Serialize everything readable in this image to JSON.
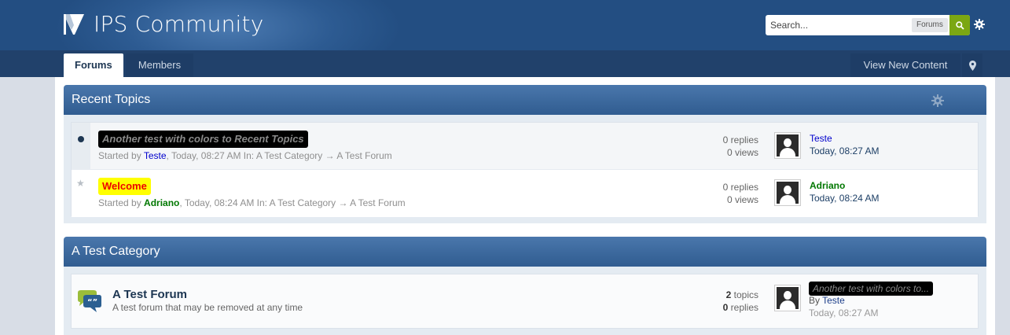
{
  "header": {
    "site_title": "IPS Community",
    "search_placeholder": "Search...",
    "search_scope": "Forums"
  },
  "nav": {
    "tabs": [
      {
        "label": "Forums",
        "active": true
      },
      {
        "label": "Members",
        "active": false
      }
    ],
    "view_new_content": "View New Content"
  },
  "recent_topics": {
    "title": "Recent Topics",
    "topics": [
      {
        "title": "Another test with colors to Recent Topics",
        "started_by_prefix": "Started by ",
        "author": "Teste",
        "meta_suffix": ", Today, 08:27 AM In: A Test Category → A Test Forum",
        "replies": "0 replies",
        "views": "0 views",
        "last_poster": "Teste",
        "last_date": "Today, 08:27 AM",
        "unread": true
      },
      {
        "title": "Welcome",
        "started_by_prefix": "Started by ",
        "author": "Adriano",
        "meta_suffix": ", Today, 08:24 AM In: A Test Category → A Test Forum",
        "replies": "0 replies",
        "views": "0 views",
        "last_poster": "Adriano",
        "last_date": "Today, 08:24 AM",
        "unread": false
      }
    ]
  },
  "category": {
    "title": "A Test Category",
    "forum": {
      "name": "A Test Forum",
      "description": "A test forum that may be removed at any time",
      "topics_count": "2",
      "topics_label": " topics",
      "replies_count": "0",
      "replies_label": " replies",
      "last_post_title": "Another test with colors to...",
      "last_post_by_prefix": "By ",
      "last_post_by": "Teste",
      "last_post_date": "Today, 08:27 AM"
    }
  },
  "colors": {
    "header_blue": "#2d5b92",
    "nav_dark": "#21416b",
    "search_green": "#7ba713",
    "author_blue": "#0000cc",
    "author_green": "#007700",
    "highlight_yellow": "#ffff00"
  }
}
